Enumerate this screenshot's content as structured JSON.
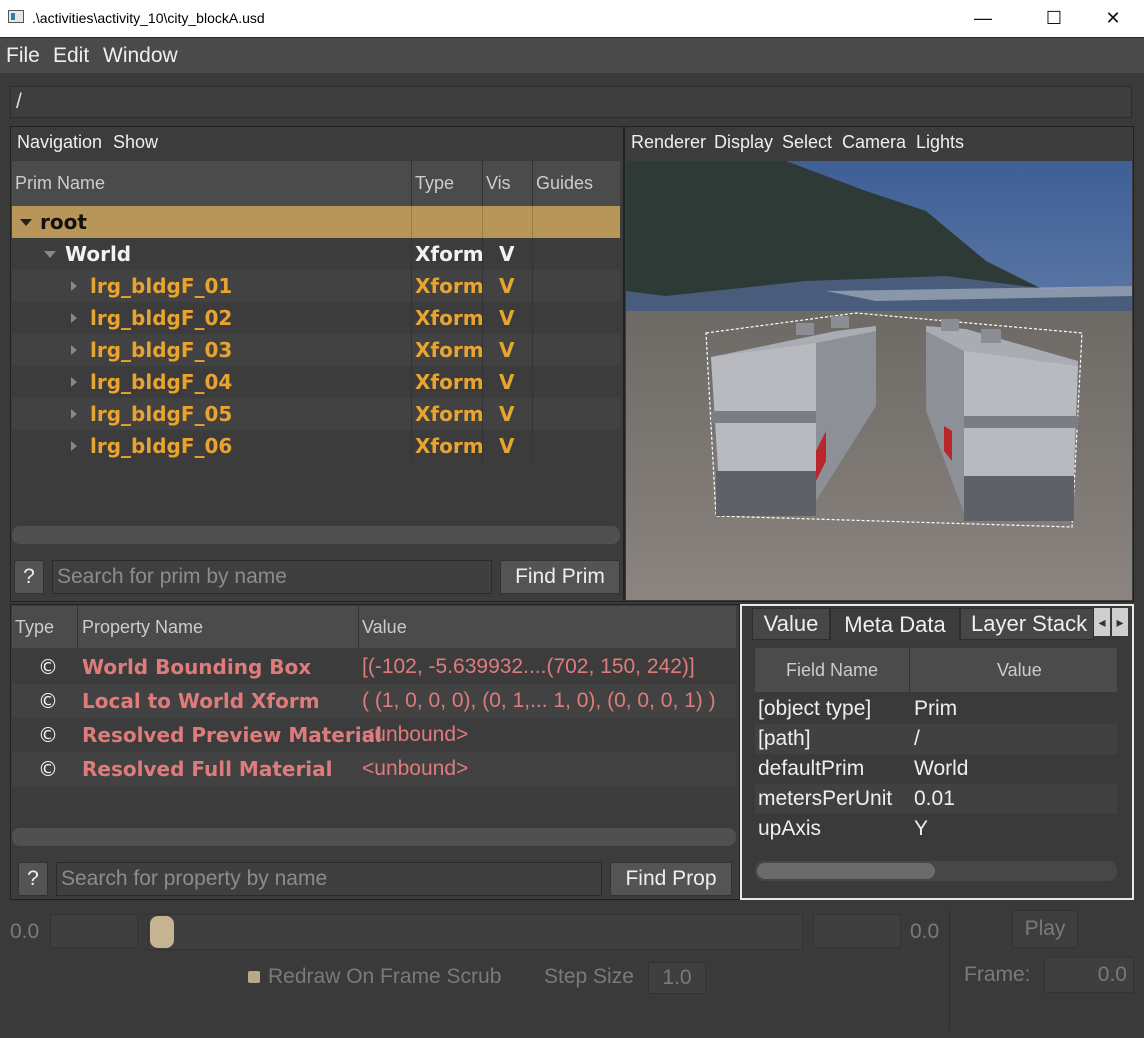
{
  "window": {
    "title": ".\\activities\\activity_10\\city_blockA.usd",
    "minimize_glyph": "—",
    "maximize_glyph": "☐",
    "close_glyph": "✕"
  },
  "menu": [
    "File",
    "Edit",
    "Window"
  ],
  "path": "/",
  "prim_browser": {
    "menu": [
      "Navigation",
      "Show"
    ],
    "columns": [
      "Prim Name",
      "Type",
      "Vis",
      "Guides"
    ],
    "root": {
      "name": "root"
    },
    "world": {
      "name": "World",
      "type": "Xform",
      "vis": "V"
    },
    "items": [
      {
        "name": "lrg_bldgF_01",
        "type": "Xform",
        "vis": "V"
      },
      {
        "name": "lrg_bldgF_02",
        "type": "Xform",
        "vis": "V"
      },
      {
        "name": "lrg_bldgF_03",
        "type": "Xform",
        "vis": "V"
      },
      {
        "name": "lrg_bldgF_04",
        "type": "Xform",
        "vis": "V"
      },
      {
        "name": "lrg_bldgF_05",
        "type": "Xform",
        "vis": "V"
      },
      {
        "name": "lrg_bldgF_06",
        "type": "Xform",
        "vis": "V"
      }
    ],
    "help_label": "?",
    "search_placeholder": "Search for prim by name",
    "find_label": "Find Prim"
  },
  "viewport": {
    "menu": [
      "Renderer",
      "Display",
      "Select",
      "Camera",
      "Lights"
    ]
  },
  "properties": {
    "columns": [
      "Type",
      "Property Name",
      "Value"
    ],
    "rows": [
      {
        "type": "©",
        "name": "World Bounding Box",
        "value": "[(-102, -5.639932....(702, 150, 242)]"
      },
      {
        "type": "©",
        "name": "Local to World Xform",
        "value": "( (1, 0, 0, 0), (0, 1,... 1, 0), (0, 0, 0, 1) )"
      },
      {
        "type": "©",
        "name": "Resolved Preview Material",
        "value": "<unbound>"
      },
      {
        "type": "©",
        "name": "Resolved Full Material",
        "value": "<unbound>"
      }
    ],
    "help_label": "?",
    "search_placeholder": "Search for property by name",
    "find_label": "Find Prop"
  },
  "metadata": {
    "tabs": [
      "Value",
      "Meta Data",
      "Layer Stack"
    ],
    "active_tab": "Meta Data",
    "columns": [
      "Field Name",
      "Value"
    ],
    "rows": [
      {
        "field": "[object type]",
        "value": "Prim"
      },
      {
        "field": "[path]",
        "value": "/"
      },
      {
        "field": "defaultPrim",
        "value": "World"
      },
      {
        "field": "metersPerUnit",
        "value": "0.01"
      },
      {
        "field": "upAxis",
        "value": "Y"
      }
    ],
    "scroll_left_glyph": "◂",
    "scroll_right_glyph": "▸"
  },
  "timeline": {
    "start_label": "0.0",
    "end_label": "0.0",
    "play_label": "Play",
    "redraw_label": "Redraw On Frame Scrub",
    "step_size_label": "Step Size",
    "step_size_value": "1.0",
    "frame_label": "Frame:",
    "frame_value": "0.0"
  },
  "colors": {
    "prim_text": "#e8a330",
    "property_text": "#e07b7b",
    "selected_row": "#b89558",
    "background": "#3a3a3a"
  }
}
